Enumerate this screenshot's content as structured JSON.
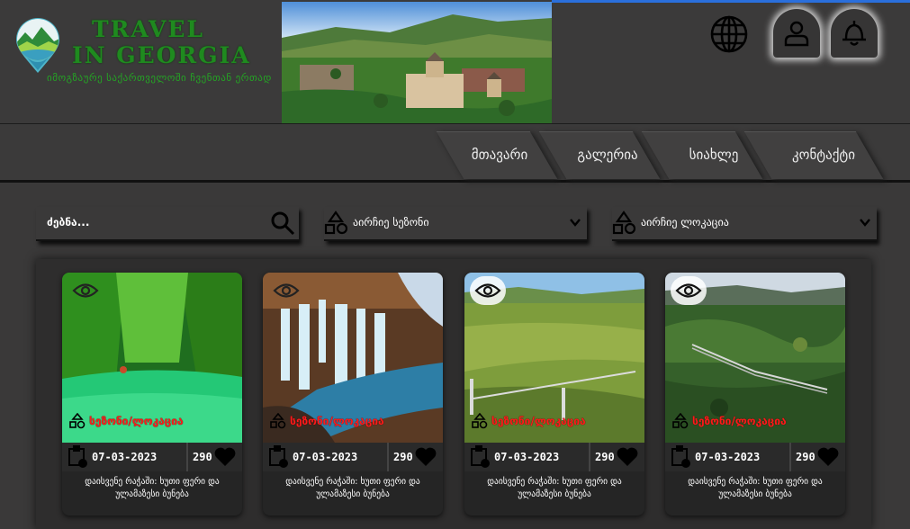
{
  "header": {
    "brand_line1": "TRAVEL",
    "brand_line2": "IN GEORGIA",
    "brand_sub": "იმოგზაურე საქართველოში ჩვენთან ერთად"
  },
  "nav": {
    "tabs": [
      {
        "label": "მთავარი"
      },
      {
        "label": "გალერია"
      },
      {
        "label": "სიახლე"
      },
      {
        "label": "კონტაქტი"
      }
    ]
  },
  "filters": {
    "search_label": "ძებნა...",
    "season_select": "აირჩიე სეზონი",
    "location_select": "აირჩიე ლოკაცია"
  },
  "cards": [
    {
      "season_location": "სეზონი/ლოკაცია",
      "date": "07-03-2023",
      "likes": "290",
      "title": "დაისვენე რაჭაში: ხუთი ფერი და ულამაზესი ბუნება"
    },
    {
      "season_location": "სეზონი/ლოკაცია",
      "date": "07-03-2023",
      "likes": "290",
      "title": "დაისვენე რაჭაში: ხუთი ფერი და ულამაზესი ბუნება"
    },
    {
      "season_location": "სეზონი/ლოკაცია",
      "date": "07-03-2023",
      "likes": "290",
      "title": "დაისვენე რაჭაში: ხუთი ფერი და ულამაზესი ბუნება"
    },
    {
      "season_location": "სეზონი/ლოკაცია",
      "date": "07-03-2023",
      "likes": "290",
      "title": "დაისვენე რაჭაში: ხუთი ფერი და ულამაზესი ბუნება"
    }
  ],
  "icons": {
    "search": "search-icon",
    "globe": "globe-icon",
    "user": "user-icon",
    "bell": "bell-icon",
    "eye": "eye-icon",
    "shapes": "shapes-icon",
    "calendar": "calendar-clock-icon",
    "heart": "heart-icon"
  },
  "colors": {
    "brand_green": "#1f8a1f",
    "season_red": "#ff1a1a",
    "background": "#3a3939"
  }
}
